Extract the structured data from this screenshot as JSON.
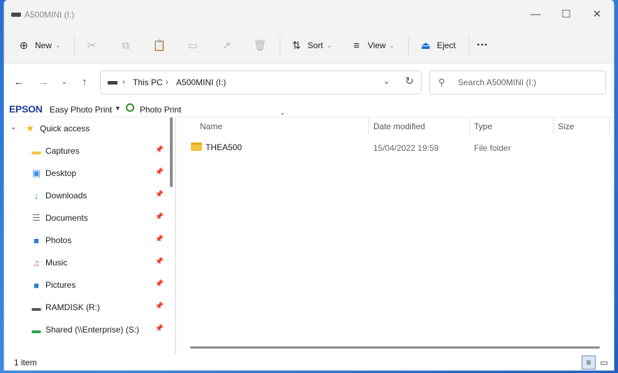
{
  "window": {
    "title": "A500MINI (I:)"
  },
  "toolbar": {
    "new_label": "New",
    "sort_label": "Sort",
    "view_label": "View",
    "eject_label": "Eject",
    "more_label": "···"
  },
  "navigation": {
    "breadcrumb": [
      "This PC",
      "A500MINI (I:)"
    ],
    "search_placeholder": "Search A500MINI (I:)"
  },
  "epson_bar": {
    "brand": "EPSON",
    "easy_photo_print": "Easy Photo Print",
    "photo_print": "Photo Print"
  },
  "sidebar": {
    "items": [
      {
        "label": "Quick access",
        "icon": "star-icon",
        "color": "#f2b705",
        "pinned": false
      },
      {
        "label": "Captures",
        "icon": "folder-icon",
        "color": "#f5c242",
        "pinned": true
      },
      {
        "label": "Desktop",
        "icon": "desktop-icon",
        "color": "#3a8fe0",
        "pinned": true
      },
      {
        "label": "Downloads",
        "icon": "download-icon",
        "color": "#1aa06a",
        "pinned": true
      },
      {
        "label": "Documents",
        "icon": "document-icon",
        "color": "#6b7b8c",
        "pinned": true
      },
      {
        "label": "Photos",
        "icon": "photos-icon",
        "color": "#2a7bd6",
        "pinned": true
      },
      {
        "label": "Music",
        "icon": "music-icon",
        "color": "#e2603a",
        "pinned": true
      },
      {
        "label": "Pictures",
        "icon": "pictures-icon",
        "color": "#2a7bd6",
        "pinned": true
      },
      {
        "label": "RAMDISK (R:)",
        "icon": "drive-icon",
        "color": "#555555",
        "pinned": true
      },
      {
        "label": "Shared (\\\\Enterprise) (S:)",
        "icon": "network-drive-icon",
        "color": "#2e9e4a",
        "pinned": true
      }
    ]
  },
  "columns": {
    "name": "Name",
    "date_modified": "Date modified",
    "type": "Type",
    "size": "Size"
  },
  "files": [
    {
      "name": "THEA500",
      "date_modified": "15/04/2022 19:59",
      "type": "File folder",
      "size": ""
    }
  ],
  "status": {
    "item_count": "1 item"
  }
}
